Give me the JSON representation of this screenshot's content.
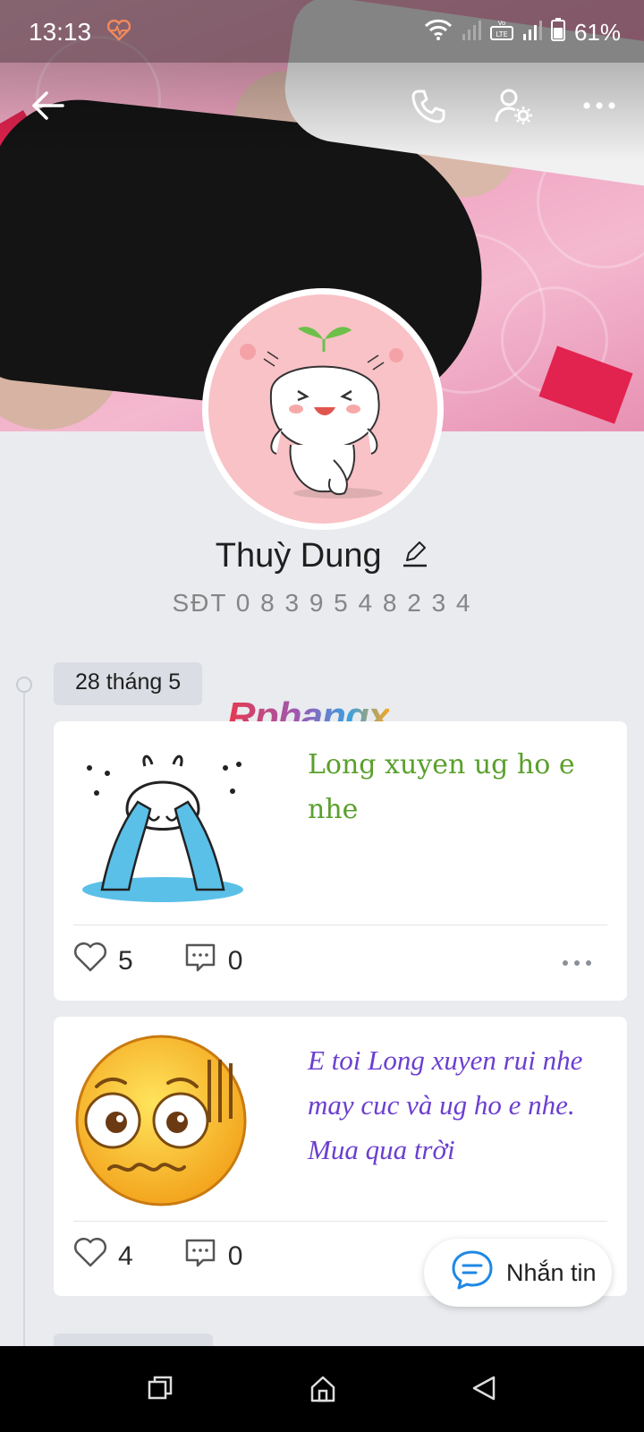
{
  "status_bar": {
    "time": "13:13",
    "battery": "61%",
    "icons": [
      "health-heart-icon",
      "wifi-icon",
      "signal-icon",
      "volte-icon",
      "signal-icon",
      "battery-icon"
    ]
  },
  "profile": {
    "name": "Thuỳ Dung",
    "phone": "SĐT 0 8 3 9 5 4 8 2 3 4"
  },
  "watermark": "Rphangx",
  "timeline": {
    "date_label": "28 tháng 5",
    "posts": [
      {
        "text": "Long xuyen ug ho e nhe",
        "likes": "5",
        "comments": "0",
        "sticker": "crying-bunny-sticker"
      },
      {
        "text": "E toi Long xuyen rui nhe may cuc và ug ho e nhe. Mua qua trời",
        "likes": "4",
        "comments": "0",
        "sticker": "worried-face-emoji"
      }
    ]
  },
  "message_button": {
    "label": "Nhắn tin"
  },
  "colors": {
    "post1_text": "#5aa02c",
    "post2_text": "#6b3fd0",
    "accent_blue": "#1e88e5",
    "background": "#e9ebef"
  }
}
